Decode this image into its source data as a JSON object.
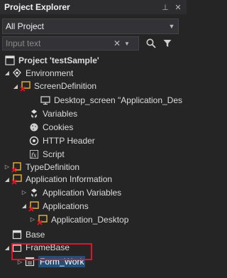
{
  "panel": {
    "title": "Project Explorer",
    "pin_glyph": "⊥",
    "close_glyph": "✕"
  },
  "scope": {
    "value": "All Project"
  },
  "search": {
    "placeholder": "Input text",
    "clear_glyph": "✕",
    "dropdown_glyph": "▼"
  },
  "tree": {
    "project": "Project 'testSample'",
    "environment": "Environment",
    "screen_definition": "ScreenDefinition",
    "desktop_screen": "Desktop_screen \"Application_Des",
    "variables": "Variables",
    "cookies": "Cookies",
    "http_header": "HTTP Header",
    "script": "Script",
    "type_definition": "TypeDefinition",
    "application_information": "Application Information",
    "application_variables": "Application Variables",
    "applications": "Applications",
    "application_desktop": "Application_Desktop",
    "base": "Base",
    "frame_base": "FrameBase",
    "form_work": "Form_Work"
  },
  "colors": {
    "background": "#252526",
    "selection": "#264f78",
    "highlight_border": "#e81123",
    "warning_icon": "#e8b53c",
    "error_mark": "#e81123"
  }
}
